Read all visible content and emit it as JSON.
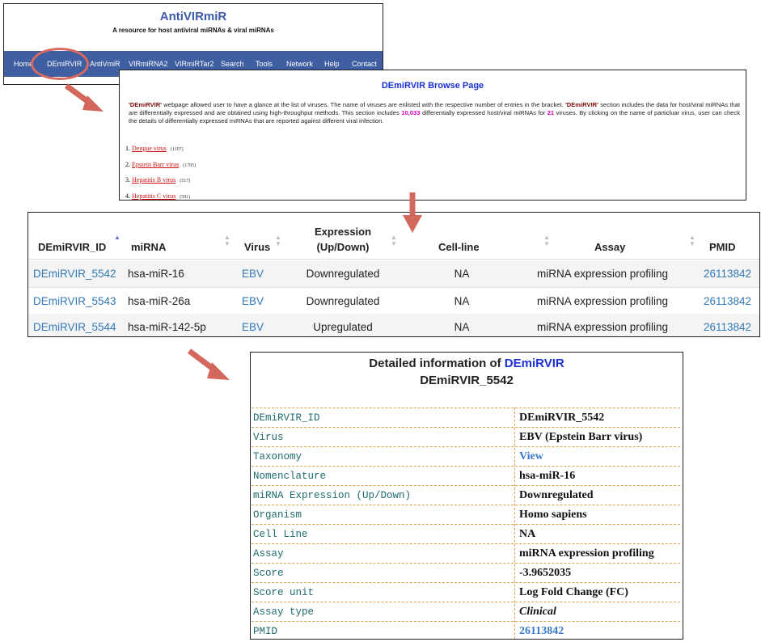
{
  "header": {
    "site_title": "AntiVIRmiR",
    "tagline": "A resource for host antiviral miRNAs & viral miRNAs",
    "nav": [
      {
        "label": "Home"
      },
      {
        "label": "DEmiRVIR"
      },
      {
        "label": "AntiVmiR"
      },
      {
        "label": "VIRmiRNA2"
      },
      {
        "label": "VIRmiRTar2"
      },
      {
        "label": "Search"
      },
      {
        "label": "Tools"
      },
      {
        "label": "Network"
      },
      {
        "label": "Help"
      },
      {
        "label": "Contact"
      }
    ],
    "highlight_color": "#d96a5f"
  },
  "browse": {
    "title": "DEmiRVIR Browse Page",
    "desc_name": "'DEmiRVIR'",
    "desc_part1": " webpage allowed user to have a glance at the list of viruses. The name of viruses are enlisted with the respective number of entries in the bracket. ",
    "desc_part2": " section includes the data for host/viral miRNAs that are differentially expressed and are obtained using high-throughput methods. This section includes ",
    "desc_count": "10,033",
    "desc_part3": " differentially expressed host/viral miRNAs for ",
    "desc_viruses": "21",
    "desc_part4": " viruses. By clicking on the name of particluar virus, user can check the details of differentially expressed miRNAs that are reported against different viral infection.",
    "viruses": [
      {
        "num": "1.",
        "name": "Dengue virus",
        "count": "(1107)"
      },
      {
        "num": "2.",
        "name": "Epstein Barr virus",
        "count": "(1705)"
      },
      {
        "num": "3.",
        "name": "Hepatitis B virus",
        "count": "(517)"
      },
      {
        "num": "4.",
        "name": "Hepatitis C virus",
        "count": "(591)"
      }
    ]
  },
  "results": {
    "columns": [
      {
        "label": "DEmiRVIR_ID"
      },
      {
        "label": "miRNA"
      },
      {
        "label": "Virus"
      },
      {
        "label": "Expression\n(Up/Down)"
      },
      {
        "label": "Cell-line"
      },
      {
        "label": "Assay"
      },
      {
        "label": "PMID"
      }
    ],
    "rows": [
      {
        "id": "DEmiRVIR_5542",
        "mirna": "hsa-miR-16",
        "virus": "EBV",
        "expression": "Downregulated",
        "cell_line": "NA",
        "assay": "miRNA expression profiling",
        "pmid": "26113842"
      },
      {
        "id": "DEmiRVIR_5543",
        "mirna": "hsa-miR-26a",
        "virus": "EBV",
        "expression": "Downregulated",
        "cell_line": "NA",
        "assay": "miRNA expression profiling",
        "pmid": "26113842"
      },
      {
        "id": "DEmiRVIR_5544",
        "mirna": "hsa-miR-142-5p",
        "virus": "EBV",
        "expression": "Upregulated",
        "cell_line": "NA",
        "assay": "miRNA expression profiling",
        "pmid": "26113842"
      }
    ],
    "link_color": "#337ab7"
  },
  "detail": {
    "heading_prefix": "Detailed information of ",
    "heading_accent": "DEmiRVIR",
    "record_id": "DEmiRVIR_5542",
    "fields": [
      {
        "label": "DEmiRVIR_ID",
        "value": "DEmiRVIR_5542",
        "style": ""
      },
      {
        "label": "Virus",
        "value": "EBV (Epstein Barr virus)",
        "style": ""
      },
      {
        "label": "Taxonomy",
        "value": "View",
        "style": "link"
      },
      {
        "label": "Nomenclature",
        "value": "hsa-miR-16",
        "style": ""
      },
      {
        "label": "miRNA Expression (Up/Down)",
        "value": "Downregulated",
        "style": ""
      },
      {
        "label": "Organism",
        "value": "Homo sapiens",
        "style": ""
      },
      {
        "label": "Cell Line",
        "value": "NA",
        "style": ""
      },
      {
        "label": "Assay",
        "value": "miRNA expression profiling",
        "style": ""
      },
      {
        "label": "Score",
        "value": "-3.9652035",
        "style": ""
      },
      {
        "label": "Score unit",
        "value": "Log Fold Change (FC)",
        "style": ""
      },
      {
        "label": "Assay type",
        "value": "Clinical",
        "style": "ital"
      },
      {
        "label": "PMID",
        "value": "26113842",
        "style": "link"
      }
    ]
  },
  "arrow_color": "#d4675c"
}
